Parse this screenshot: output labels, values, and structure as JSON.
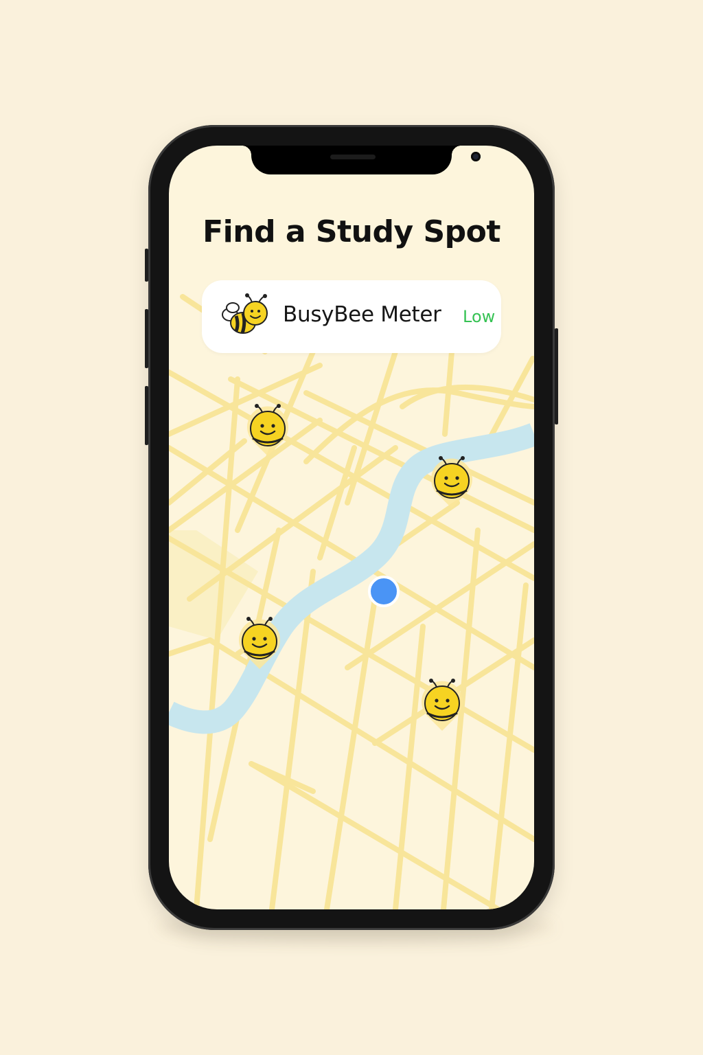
{
  "page": {
    "title": "Find a Study Spot"
  },
  "busybee_meter": {
    "label": "BusyBee Meter",
    "level": "Low",
    "level_color": "#36c254",
    "icon": "bee-icon"
  },
  "map": {
    "markers": [
      {
        "icon": "bee-icon"
      },
      {
        "icon": "bee-icon"
      },
      {
        "icon": "bee-icon"
      },
      {
        "icon": "bee-icon"
      }
    ],
    "user_location_icon": "location-dot-icon",
    "colors": {
      "background": "#fdf5dc",
      "roads": "#f8e59a",
      "river": "#c7e6ee",
      "user_location": "#4a94f5",
      "bee": "#f6d322"
    }
  }
}
